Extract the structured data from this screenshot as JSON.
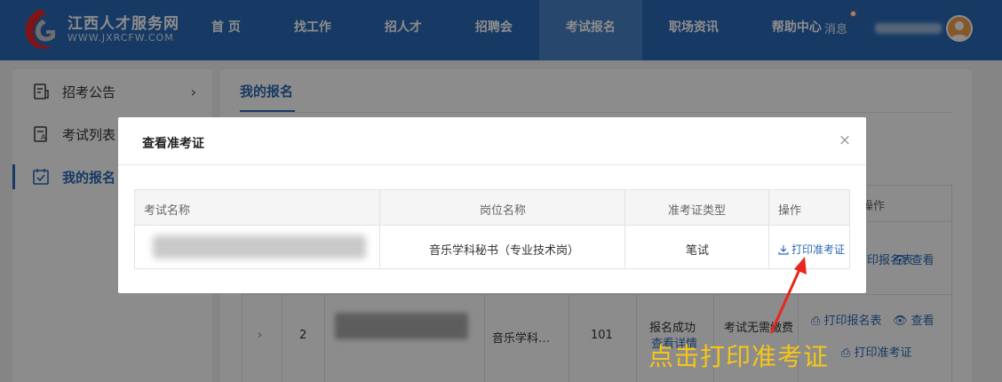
{
  "header": {
    "site_name": "江西人才服务网",
    "site_url": "WWW.JXRCFW.COM",
    "nav": [
      "首 页",
      "找工作",
      "招人才",
      "招聘会",
      "考试报名",
      "职场资讯",
      "帮助中心"
    ],
    "message_label": "消息"
  },
  "sidebar": {
    "items": [
      {
        "label": "招考公告",
        "icon": "notice-icon"
      },
      {
        "label": "考试列表",
        "icon": "exam-list-icon"
      },
      {
        "label": "我的报名",
        "icon": "my-registration-icon"
      }
    ]
  },
  "main": {
    "tab": "我的报名",
    "table": {
      "header_action": "操作",
      "row1": {
        "print_form": "打印报名表",
        "view": "查看"
      },
      "row2": {
        "index": "2",
        "position": "音乐学科…",
        "code": "101",
        "status": "报名成功",
        "status_link": "查看详情",
        "fee": "考试无需缴费",
        "print_form": "打印报名表",
        "view": "查看",
        "print_admission": "打印准考证"
      }
    }
  },
  "dialog": {
    "title": "查看准考证",
    "close": "×",
    "columns": [
      "考试名称",
      "岗位名称",
      "准考证类型",
      "操作"
    ],
    "row": {
      "position": "音乐学科秘书（专业技术岗）",
      "type": "笔试",
      "action": "打印准考证"
    }
  },
  "annotation": {
    "text": "点击打印准考证",
    "color": "#f5c518",
    "arrow_color": "#e8261c"
  },
  "colors": {
    "brand": "#2a6ab8",
    "link": "#2a6ab8"
  }
}
